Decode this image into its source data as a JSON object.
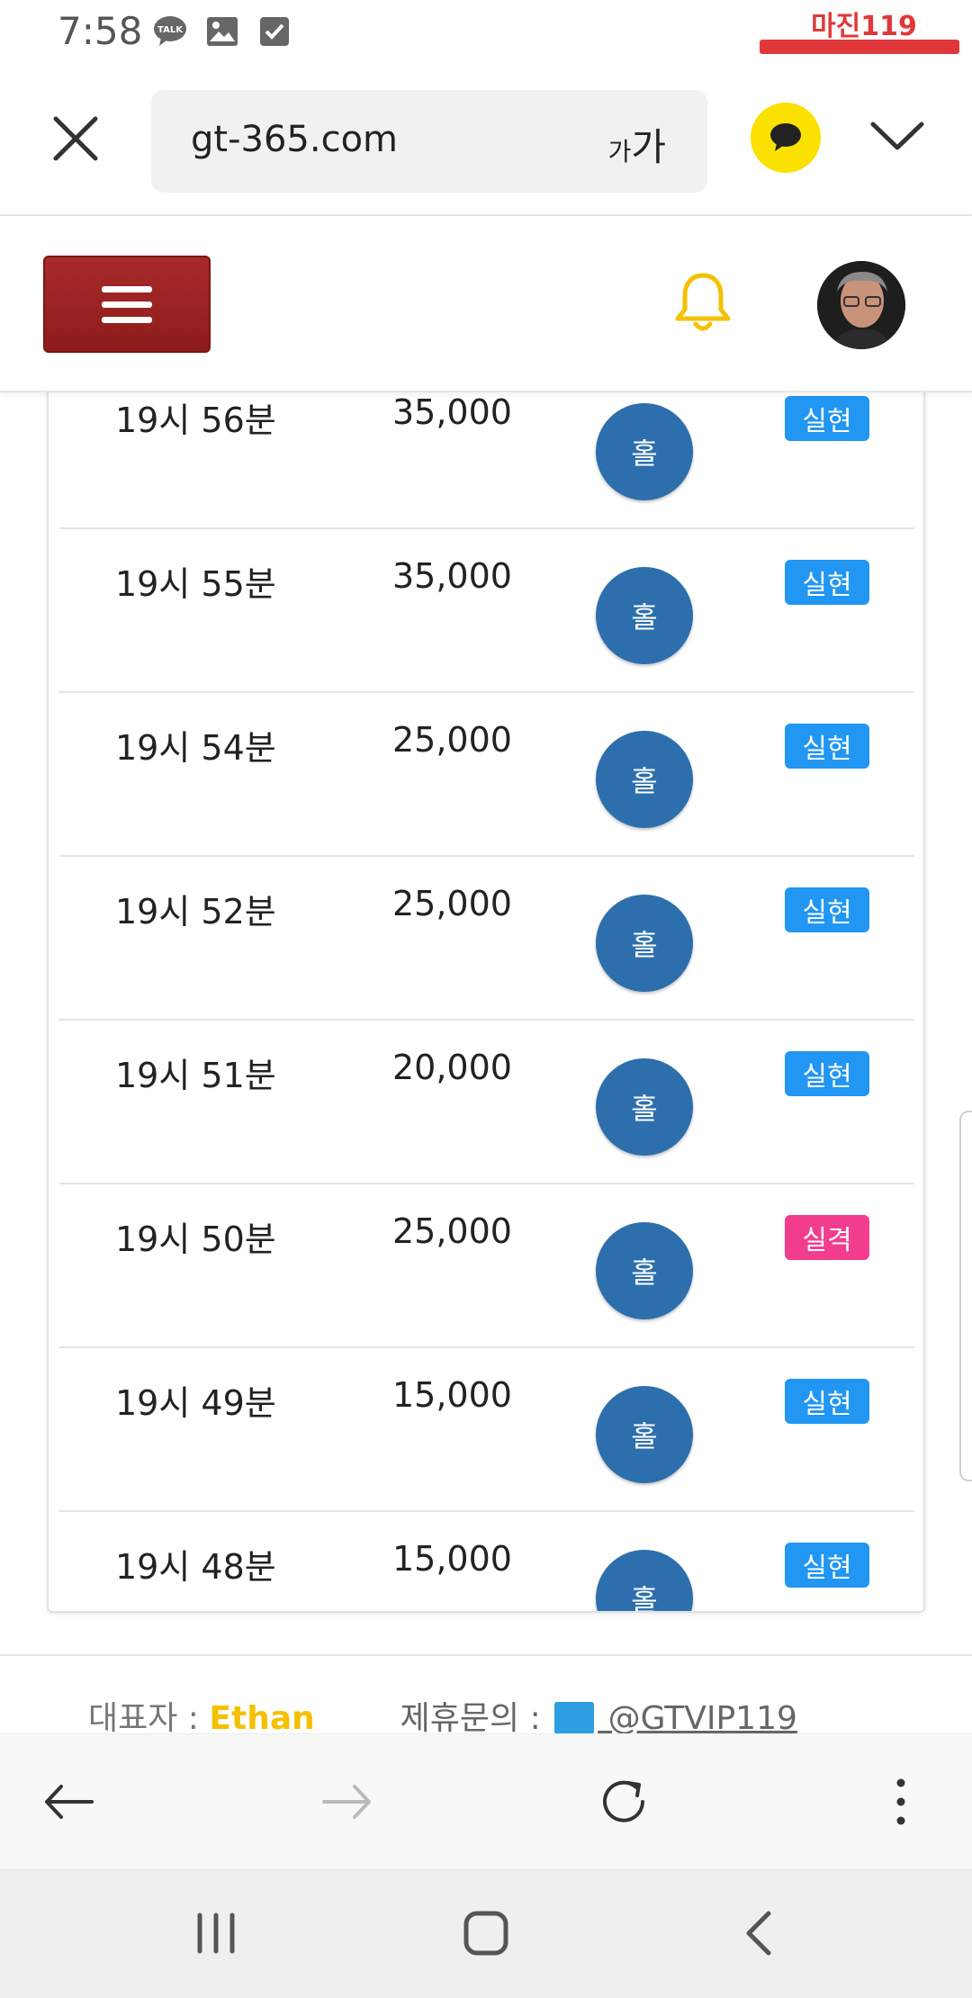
{
  "status_bar": {
    "time": "7:58",
    "icons": [
      "talk-icon",
      "gallery-icon",
      "checkbox-icon"
    ],
    "brand_logo": "마진119"
  },
  "browser": {
    "url": "gt-365.com",
    "text_size_small": "가",
    "text_size_large": "가"
  },
  "site_header": {
    "menu_color": "#9b2222",
    "bell_color": "#f5c000"
  },
  "rows": [
    {
      "time": "19시 56분",
      "amount": "35,000",
      "pick": "홀",
      "result": "실현",
      "result_color": "#2196f3"
    },
    {
      "time": "19시 55분",
      "amount": "35,000",
      "pick": "홀",
      "result": "실현",
      "result_color": "#2196f3"
    },
    {
      "time": "19시 54분",
      "amount": "25,000",
      "pick": "홀",
      "result": "실현",
      "result_color": "#2196f3"
    },
    {
      "time": "19시 52분",
      "amount": "25,000",
      "pick": "홀",
      "result": "실현",
      "result_color": "#2196f3"
    },
    {
      "time": "19시 51분",
      "amount": "20,000",
      "pick": "홀",
      "result": "실현",
      "result_color": "#2196f3"
    },
    {
      "time": "19시 50분",
      "amount": "25,000",
      "pick": "홀",
      "result": "실격",
      "result_color": "#f23d8e"
    },
    {
      "time": "19시 49분",
      "amount": "15,000",
      "pick": "홀",
      "result": "실현",
      "result_color": "#2196f3"
    },
    {
      "time": "19시 48분",
      "amount": "15,000",
      "pick": "홀",
      "result": "실현",
      "result_color": "#2196f3"
    }
  ],
  "footer": {
    "rep_label": "대표자 :",
    "rep_name": "Ethan",
    "contact_label": "제휴문의 :",
    "contact_handle": " @GTVIP119"
  }
}
